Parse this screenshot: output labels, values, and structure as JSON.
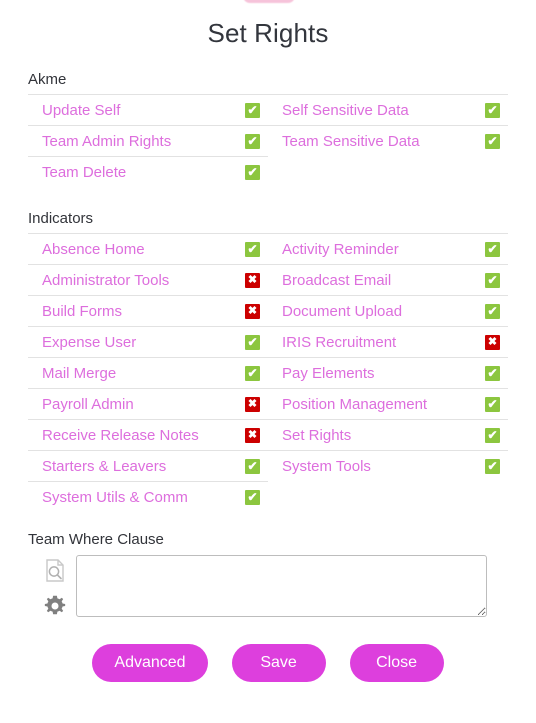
{
  "page": {
    "title": "Set Rights"
  },
  "icons": {
    "document_search": "document-search-icon",
    "gear": "gear-icon",
    "check": "✔",
    "cross": "✖"
  },
  "colors": {
    "link": "#dd6edd",
    "enabled": "#8cc63f",
    "disabled": "#cc0000",
    "button": "#dd3fdd",
    "heading_text": "#32343a",
    "row_divider": "#e2e2e2",
    "top_pill": "#f2a0c4"
  },
  "sections": [
    {
      "heading": "Akme",
      "left_column": [
        {
          "label": "Update Self",
          "state": "on"
        },
        {
          "label": "Team Admin Rights",
          "state": "on"
        },
        {
          "label": "Team Delete",
          "state": "on"
        }
      ],
      "right_column": [
        {
          "label": "Self Sensitive Data",
          "state": "on"
        },
        {
          "label": "Team Sensitive Data",
          "state": "on"
        }
      ]
    },
    {
      "heading": "Indicators",
      "left_column": [
        {
          "label": "Absence Home",
          "state": "on"
        },
        {
          "label": "Administrator Tools",
          "state": "off"
        },
        {
          "label": "Build Forms",
          "state": "off"
        },
        {
          "label": "Expense User",
          "state": "on"
        },
        {
          "label": "Mail Merge",
          "state": "on"
        },
        {
          "label": "Payroll Admin",
          "state": "off"
        },
        {
          "label": "Receive Release Notes",
          "state": "off"
        },
        {
          "label": "Starters & Leavers",
          "state": "on"
        },
        {
          "label": "System Utils & Comm",
          "state": "on"
        }
      ],
      "right_column": [
        {
          "label": "Activity Reminder",
          "state": "on"
        },
        {
          "label": "Broadcast Email",
          "state": "on"
        },
        {
          "label": "Document Upload",
          "state": "on"
        },
        {
          "label": "IRIS Recruitment",
          "state": "off"
        },
        {
          "label": "Pay Elements",
          "state": "on"
        },
        {
          "label": "Position Management",
          "state": "on"
        },
        {
          "label": "Set Rights",
          "state": "on"
        },
        {
          "label": "System Tools",
          "state": "on"
        }
      ]
    }
  ],
  "where_clause": {
    "label": "Team Where Clause",
    "value": "",
    "placeholder": ""
  },
  "buttons": {
    "advanced": "Advanced",
    "save": "Save",
    "close": "Close"
  }
}
